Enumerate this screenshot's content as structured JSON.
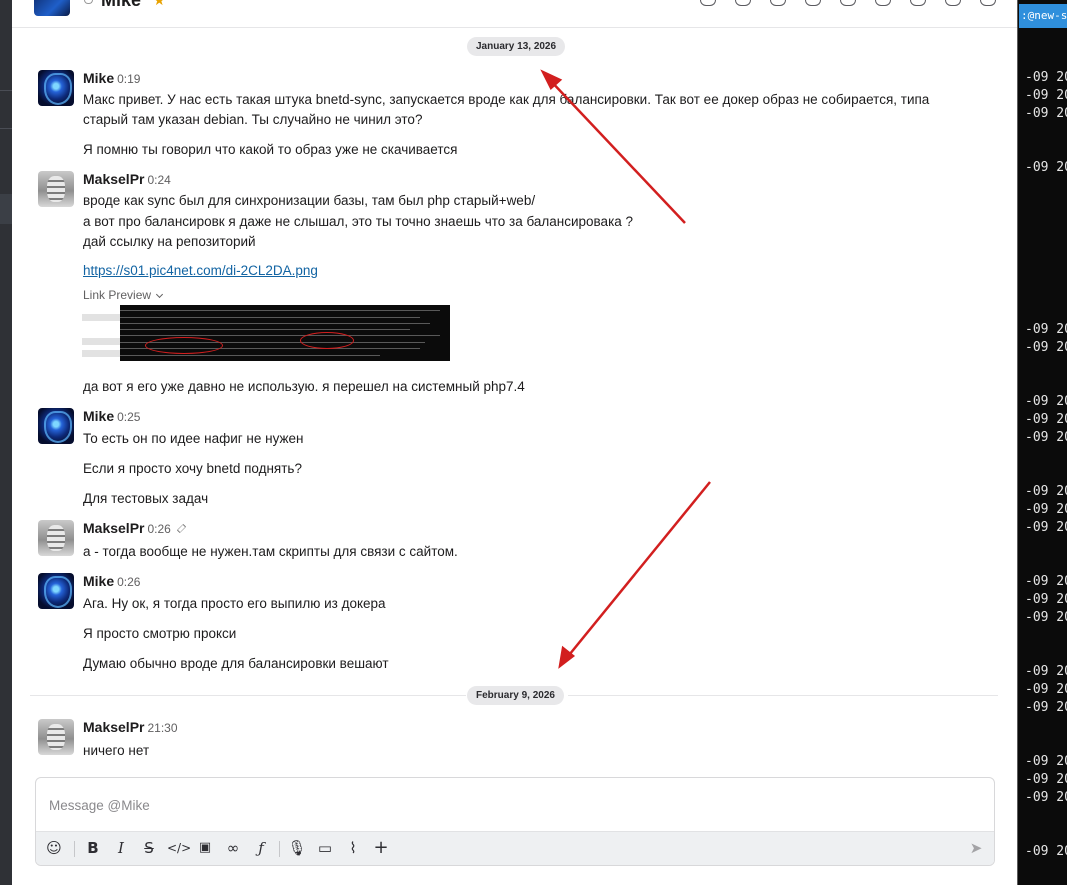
{
  "header": {
    "title": "Mike"
  },
  "dates": {
    "first": "January 13, 2026",
    "second": "February 9, 2026"
  },
  "messages": [
    {
      "author": "Mike",
      "time": "0:19",
      "lines": [
        "Макс привет. У нас есть такая штука bnetd-sync, запускается вроде как для балансировки. Так вот ее докер образ не собирается, типа",
        "старый там указан debian. Ты случайно не чинил это?",
        "Я помню ты говорил что какой то образ уже не скачивается"
      ]
    },
    {
      "author": "MakselPr",
      "time": "0:24",
      "lines": [
        "вроде как sync был для синхронизации базы, там был php старый+web/",
        "а вот про балансировк я даже не слышал, это ты точно знаешь что за балансировака ?",
        "дай ссылку на репозиторий"
      ],
      "link": "https://s01.pic4net.com/di-2CL2DA.png",
      "link_preview_label": "Link Preview",
      "after": "да вот я его уже давно не использую. я перешел на системный php7.4"
    },
    {
      "author": "Mike",
      "time": "0:25",
      "lines": [
        "То есть он по идее нафиг не нужен",
        "Если я просто хочу bnetd поднять?",
        "Для тестовых задач"
      ]
    },
    {
      "author": "MakselPr",
      "time": "0:26",
      "lines": [
        "а - тогда вообще не нужен.там скрипты для связи с сайтом."
      ]
    },
    {
      "author": "Mike",
      "time": "0:26",
      "lines": [
        "Ага. Ну ок, я тогда просто его выпилю из докера",
        "Я просто смотрю прокси",
        "Думаю обычно вроде для балансировки вешают"
      ]
    },
    {
      "author": "MakselPr",
      "time": "21:30",
      "lines": [
        "ничего нет"
      ]
    }
  ],
  "composer": {
    "placeholder": "Message @Mike",
    "value": ""
  },
  "toolbar_icons": [
    "emoji-icon",
    "bold-icon",
    "italic-icon",
    "strikethrough-icon",
    "code-icon",
    "code-block-icon",
    "link-icon",
    "formula-icon",
    "microphone-icon",
    "video-icon",
    "attachment-icon",
    "plus-icon",
    "send-icon"
  ],
  "terminal": {
    "tab": ":@new-si",
    "line": "-09 20"
  },
  "colors": {
    "accent": "#1264a3",
    "annotation": "#d21f1f",
    "terminal_tab": "#2f8fdc"
  }
}
